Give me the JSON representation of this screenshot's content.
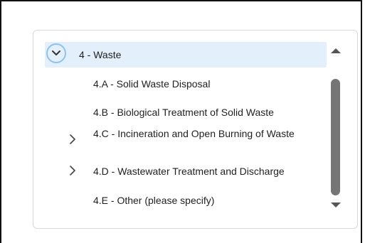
{
  "tree": {
    "root": {
      "label": "4 - Waste",
      "expanded": true
    },
    "children": [
      {
        "label": "4.A - Solid Waste Disposal",
        "has_children": false
      },
      {
        "label": "4.B - Biological Treatment of Solid Waste",
        "has_children": false
      },
      {
        "label": "4.C - Incineration and Open Burning of Waste",
        "has_children": true
      },
      {
        "label": "4.D - Wastewater Treatment and Discharge",
        "has_children": true
      },
      {
        "label": "4.E - Other (please specify)",
        "has_children": false
      }
    ]
  },
  "colors": {
    "selected_row_bg": "#e3f0fb",
    "toggle_ring": "#8cc3ee",
    "scroll_thumb": "#757575"
  },
  "icons": {
    "root_toggle": "chevron-down-icon",
    "collapsed_node": "chevron-right-icon"
  }
}
